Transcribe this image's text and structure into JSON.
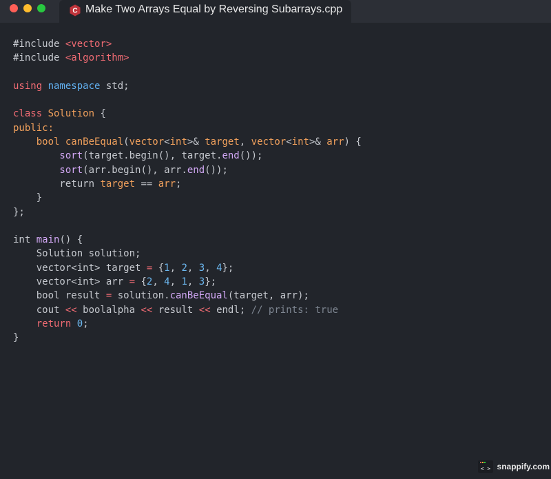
{
  "window": {
    "tab_title": "Make Two Arrays Equal by Reversing Subarrays.cpp",
    "tab_icon": "cpp-logo-icon"
  },
  "code_lines": [
    [
      [
        "#include ",
        "plain"
      ],
      [
        "<vector>",
        "kw-red"
      ]
    ],
    [
      [
        "#include ",
        "plain"
      ],
      [
        "<algorithm>",
        "kw-red"
      ]
    ],
    [],
    [
      [
        "using ",
        "kw-red"
      ],
      [
        "namespace ",
        "kw-blue"
      ],
      [
        "std;",
        "plain"
      ]
    ],
    [],
    [
      [
        "class ",
        "kw-red"
      ],
      [
        "Solution ",
        "kw-orange"
      ],
      [
        "{",
        "plain"
      ]
    ],
    [
      [
        "public:",
        "kw-orange"
      ]
    ],
    [
      [
        "    bool ",
        "kw-orange"
      ],
      [
        "canBeEqual",
        "kw-orange"
      ],
      [
        "(",
        "plain"
      ],
      [
        "vector",
        "kw-orange"
      ],
      [
        "<",
        "plain"
      ],
      [
        "int",
        "kw-orange"
      ],
      [
        ">& ",
        "plain"
      ],
      [
        "target",
        "kw-orange"
      ],
      [
        ", ",
        "plain"
      ],
      [
        "vector",
        "kw-orange"
      ],
      [
        "<",
        "plain"
      ],
      [
        "int",
        "kw-orange"
      ],
      [
        ">& ",
        "plain"
      ],
      [
        "arr",
        "kw-orange"
      ],
      [
        ") {",
        "plain"
      ]
    ],
    [
      [
        "        sort",
        "fn"
      ],
      [
        "(target.begin(), target.",
        "plain"
      ],
      [
        "end",
        "fn"
      ],
      [
        "());",
        "plain"
      ]
    ],
    [
      [
        "        sort",
        "fn"
      ],
      [
        "(arr.begin(), arr.",
        "plain"
      ],
      [
        "end",
        "fn"
      ],
      [
        "());",
        "plain"
      ]
    ],
    [
      [
        "        return ",
        "plain"
      ],
      [
        "target ",
        "kw-orange"
      ],
      [
        "== ",
        "plain"
      ],
      [
        "arr",
        "kw-orange"
      ],
      [
        ";",
        "plain"
      ]
    ],
    [
      [
        "    }",
        "plain"
      ]
    ],
    [
      [
        "};",
        "plain"
      ]
    ],
    [],
    [
      [
        "int ",
        "plain"
      ],
      [
        "main",
        "fn"
      ],
      [
        "() {",
        "plain"
      ]
    ],
    [
      [
        "    Solution solution;",
        "plain"
      ]
    ],
    [
      [
        "    vector<int> target ",
        "plain"
      ],
      [
        "= ",
        "kw-red"
      ],
      [
        "{",
        "plain"
      ],
      [
        "1",
        "num"
      ],
      [
        ", ",
        "plain"
      ],
      [
        "2",
        "num"
      ],
      [
        ", ",
        "plain"
      ],
      [
        "3",
        "num"
      ],
      [
        ", ",
        "plain"
      ],
      [
        "4",
        "num"
      ],
      [
        "};",
        "plain"
      ]
    ],
    [
      [
        "    vector<int> arr ",
        "plain"
      ],
      [
        "= ",
        "kw-red"
      ],
      [
        "{",
        "plain"
      ],
      [
        "2",
        "num"
      ],
      [
        ", ",
        "plain"
      ],
      [
        "4",
        "num"
      ],
      [
        ", ",
        "plain"
      ],
      [
        "1",
        "num"
      ],
      [
        ", ",
        "plain"
      ],
      [
        "3",
        "num"
      ],
      [
        "};",
        "plain"
      ]
    ],
    [
      [
        "    bool result ",
        "plain"
      ],
      [
        "= ",
        "kw-red"
      ],
      [
        "solution.",
        "plain"
      ],
      [
        "canBeEqual",
        "fn"
      ],
      [
        "(target, arr);",
        "plain"
      ]
    ],
    [
      [
        "    cout ",
        "plain"
      ],
      [
        "<< ",
        "kw-red"
      ],
      [
        "boolalpha ",
        "plain"
      ],
      [
        "<< ",
        "kw-red"
      ],
      [
        "result ",
        "plain"
      ],
      [
        "<< ",
        "kw-red"
      ],
      [
        "endl; ",
        "plain"
      ],
      [
        "// prints: true",
        "comment"
      ]
    ],
    [
      [
        "    return ",
        "kw-red"
      ],
      [
        "0",
        "num"
      ],
      [
        ";",
        "plain"
      ]
    ],
    [
      [
        "}",
        "plain"
      ]
    ]
  ],
  "footer": {
    "brand": "snappify.com",
    "brand_icon": "code-brackets-icon"
  }
}
